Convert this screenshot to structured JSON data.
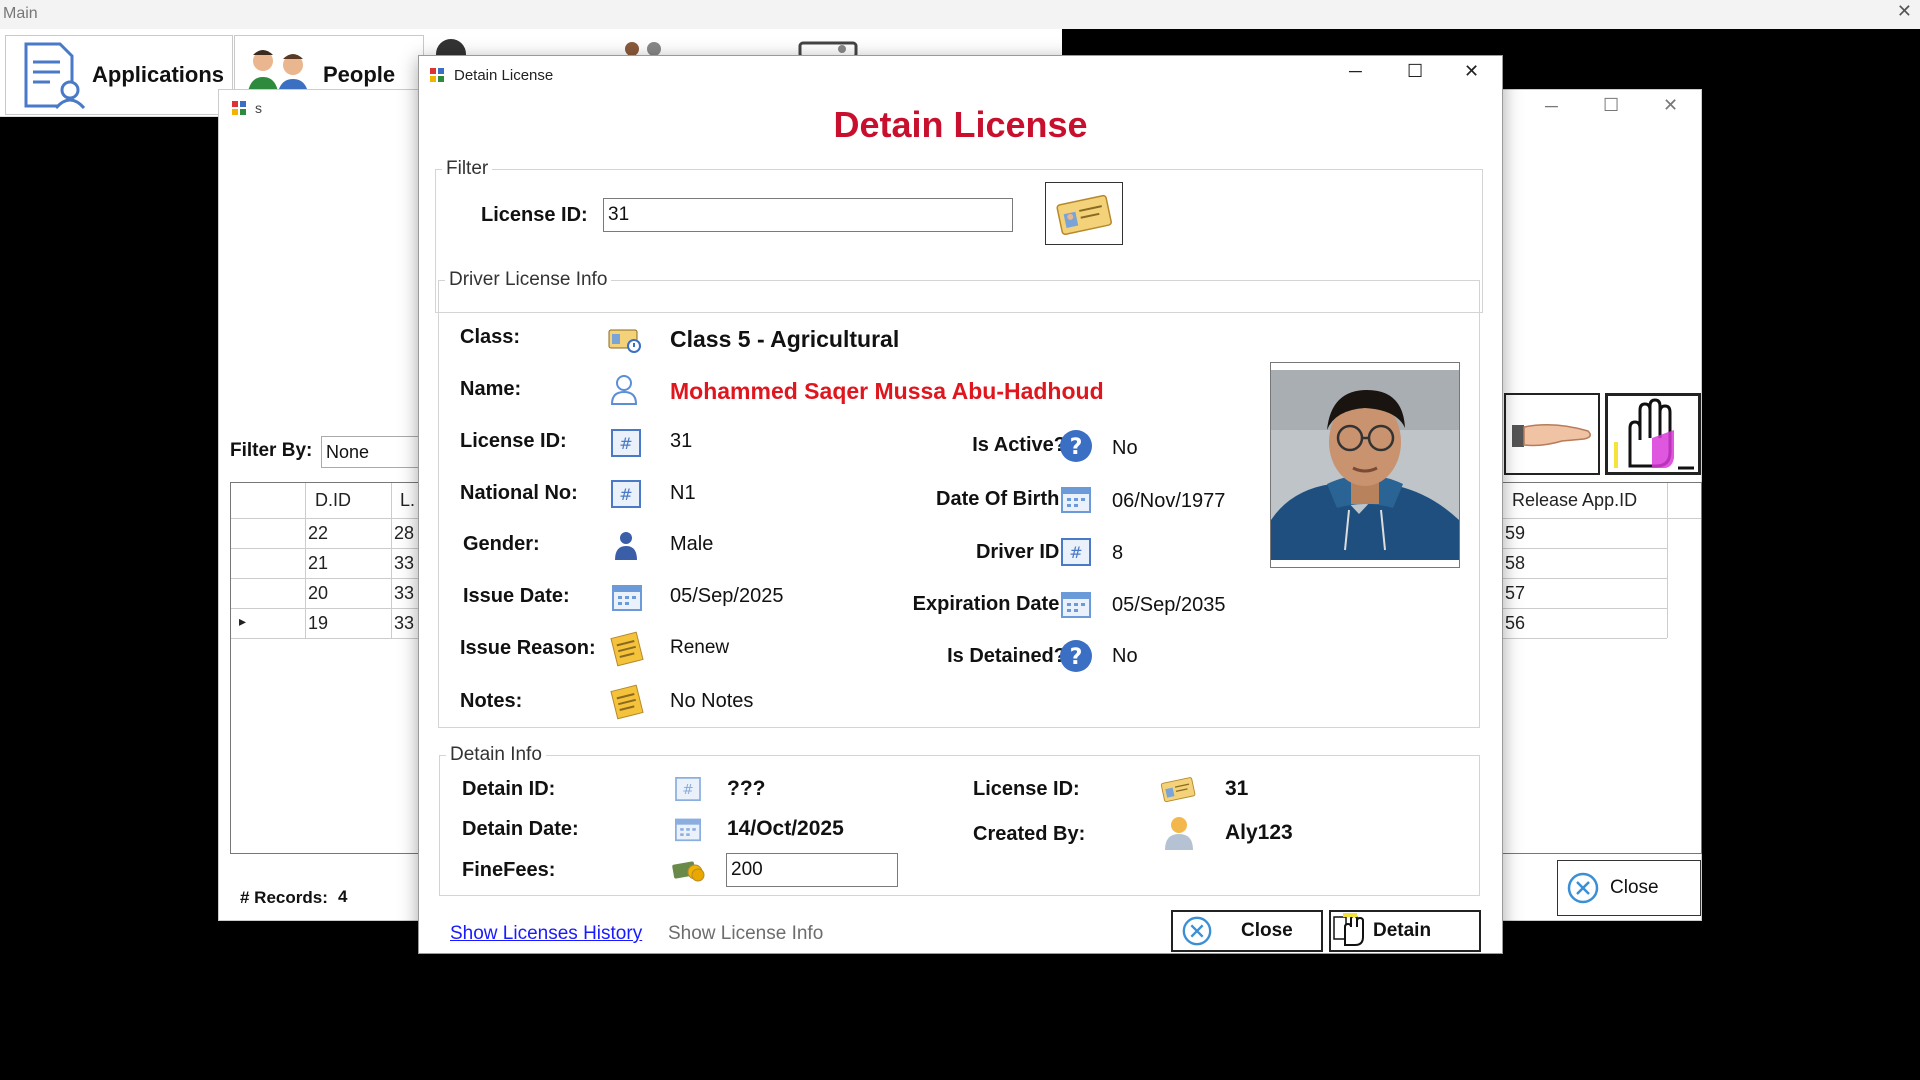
{
  "main": {
    "title": "Main",
    "menu": {
      "applications": "Applications",
      "people": "People"
    }
  },
  "bg_window": {
    "title": "s",
    "filter_label": "Filter By:",
    "filter_value": "None",
    "columns": [
      "D.ID",
      "L.",
      "Release App.ID"
    ],
    "rows": [
      {
        "did": "22",
        "lid": "28",
        "rel": "59"
      },
      {
        "did": "21",
        "lid": "33",
        "rel": "58"
      },
      {
        "did": "20",
        "lid": "33",
        "rel": "57"
      },
      {
        "did": "19",
        "lid": "33",
        "rel": "56"
      }
    ],
    "records_label": "# Records:",
    "records_count": "4",
    "close_label": "Close"
  },
  "dialog": {
    "title": "Detain License",
    "heading": "Detain License",
    "filter": {
      "legend": "Filter",
      "license_id_label": "License ID:",
      "license_id_value": "31"
    },
    "driver_info": {
      "legend": "Driver License Info",
      "class_label": "Class:",
      "class_value": "Class 5 - Agricultural",
      "name_label": "Name:",
      "name_value": "Mohammed Saqer Mussa Abu-Hadhoud",
      "license_id_label": "License ID:",
      "license_id_value": "31",
      "national_no_label": "National No:",
      "national_no_value": "N1",
      "gender_label": "Gender:",
      "gender_value": "Male",
      "issue_date_label": "Issue Date:",
      "issue_date_value": "05/Sep/2025",
      "issue_reason_label": "Issue Reason:",
      "issue_reason_value": "Renew",
      "notes_label": "Notes:",
      "notes_value": "No Notes",
      "is_active_label": "Is Active?",
      "is_active_value": "No",
      "dob_label": "Date Of Birth:",
      "dob_value": "06/Nov/1977",
      "driver_id_label": "Driver ID:",
      "driver_id_value": "8",
      "expiration_label": "Expiration Date:",
      "expiration_value": "05/Sep/2035",
      "is_detained_label": "Is Detained?",
      "is_detained_value": "No"
    },
    "detain_info": {
      "legend": "Detain Info",
      "detain_id_label": "Detain ID:",
      "detain_id_value": "???",
      "detain_date_label": "Detain Date:",
      "detain_date_value": "14/Oct/2025",
      "fine_fees_label": "FineFees:",
      "fine_fees_value": "200",
      "license_id_label": "License ID:",
      "license_id_value": "31",
      "created_by_label": "Created By:",
      "created_by_value": "Aly123"
    },
    "show_history_link": "Show Licenses History",
    "show_info_link": "Show License Info",
    "close_button": "Close",
    "detain_button": "Detain"
  },
  "colors": {
    "heading_red": "#c8102e",
    "name_red": "#e0161e",
    "link_blue": "#1a1aff",
    "disabled_gray": "#6d6d6d",
    "icon_blue": "#3a6fc4"
  }
}
